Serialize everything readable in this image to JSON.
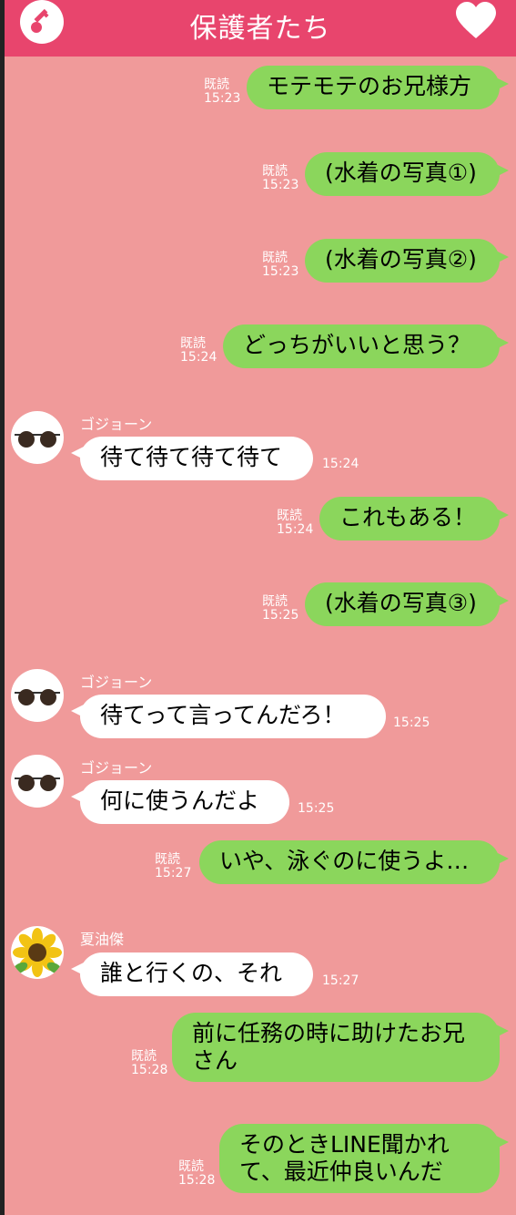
{
  "header": {
    "title": "保護者たち",
    "key_icon": "key-icon",
    "heart_icon": "heart-icon",
    "colors": {
      "header": "#e8456d",
      "background": "#f09a9a",
      "out_bubble": "#8bd65c",
      "in_bubble": "#ffffff"
    }
  },
  "messages": [
    {
      "dir": "out",
      "text": "モテモテのお兄様方",
      "read": "既読",
      "time": "15:23"
    },
    {
      "dir": "out",
      "text": "(水着の写真①)",
      "read": "既読",
      "time": "15:23"
    },
    {
      "dir": "out",
      "text": "(水着の写真②)",
      "read": "既読",
      "time": "15:23"
    },
    {
      "dir": "out",
      "text": "どっちがいいと思う？",
      "read": "既読",
      "time": "15:24"
    },
    {
      "dir": "in",
      "sender": "ゴジョーン",
      "avatar": "sunglasses-icon",
      "text": "待て待て待て待て",
      "time": "15:24"
    },
    {
      "dir": "out",
      "text": "これもある！",
      "read": "既読",
      "time": "15:24"
    },
    {
      "dir": "out",
      "text": "(水着の写真③)",
      "read": "既読",
      "time": "15:25"
    },
    {
      "dir": "in",
      "sender": "ゴジョーン",
      "avatar": "sunglasses-icon",
      "text": "待てって言ってんだろ！",
      "time": "15:25"
    },
    {
      "dir": "in",
      "sender": "ゴジョーン",
      "avatar": "sunglasses-icon",
      "text": "何に使うんだよ",
      "time": "15:25"
    },
    {
      "dir": "out",
      "text": "いや、泳ぐのに使うよ…",
      "read": "既読",
      "time": "15:27"
    },
    {
      "dir": "in",
      "sender": "夏油傑",
      "avatar": "sunflower-icon",
      "text": "誰と行くの、それ",
      "time": "15:27"
    },
    {
      "dir": "out",
      "text": "前に任務の時に助けたお兄さん",
      "read": "既読",
      "time": "15:28"
    },
    {
      "dir": "out",
      "text": "そのときLINE聞かれて、最近仲良いんだ",
      "read": "既読",
      "time": "15:28"
    }
  ]
}
